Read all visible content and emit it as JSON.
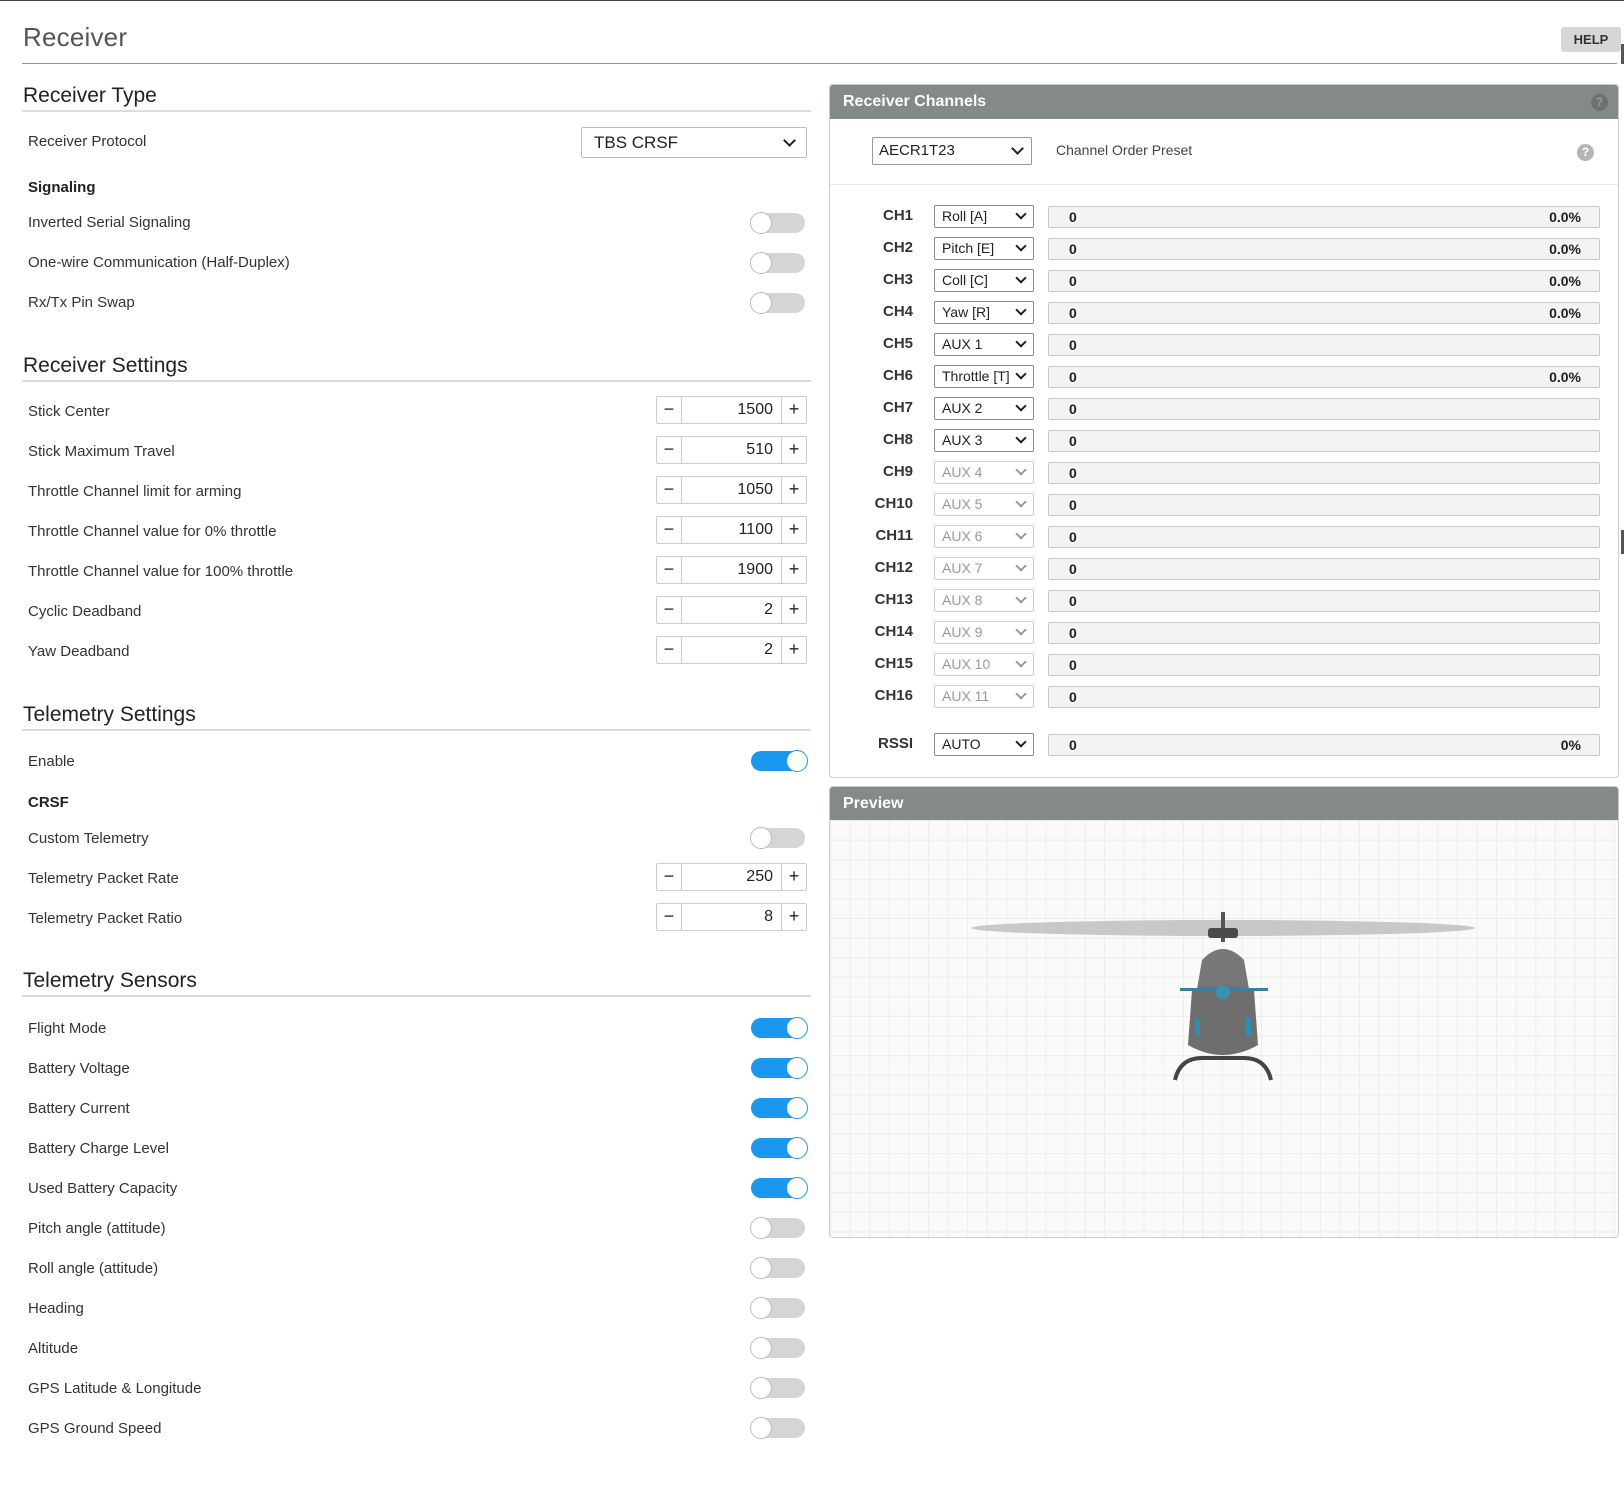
{
  "header": {
    "title": "Receiver",
    "help_label": "HELP"
  },
  "receiver_type": {
    "title": "Receiver Type",
    "protocol_label": "Receiver Protocol",
    "protocol_value": "TBS CRSF",
    "signaling_label": "Signaling",
    "toggles": [
      {
        "label": "Inverted Serial Signaling",
        "on": false
      },
      {
        "label": "One-wire Communication (Half-Duplex)",
        "on": false
      },
      {
        "label": "Rx/Tx Pin Swap",
        "on": false
      }
    ]
  },
  "receiver_settings": {
    "title": "Receiver Settings",
    "fields": [
      {
        "label": "Stick Center",
        "value": "1500"
      },
      {
        "label": "Stick Maximum Travel",
        "value": "510"
      },
      {
        "label": "Throttle Channel limit for arming",
        "value": "1050"
      },
      {
        "label": "Throttle Channel value for 0% throttle",
        "value": "1100"
      },
      {
        "label": "Throttle Channel value for 100% throttle",
        "value": "1900"
      },
      {
        "label": "Cyclic Deadband",
        "value": "2"
      },
      {
        "label": "Yaw Deadband",
        "value": "2"
      }
    ],
    "minus": "−",
    "plus": "+"
  },
  "telemetry_settings": {
    "title": "Telemetry Settings",
    "enable_label": "Enable",
    "enable_on": true,
    "crsf_label": "CRSF",
    "custom_label": "Custom Telemetry",
    "custom_on": false,
    "packet_rate_label": "Telemetry Packet Rate",
    "packet_rate_value": "250",
    "packet_ratio_label": "Telemetry Packet Ratio",
    "packet_ratio_value": "8"
  },
  "telemetry_sensors": {
    "title": "Telemetry Sensors",
    "items": [
      {
        "label": "Flight Mode",
        "on": true
      },
      {
        "label": "Battery Voltage",
        "on": true
      },
      {
        "label": "Battery Current",
        "on": true
      },
      {
        "label": "Battery Charge Level",
        "on": true
      },
      {
        "label": "Used Battery Capacity",
        "on": true
      },
      {
        "label": "Pitch angle (attitude)",
        "on": false
      },
      {
        "label": "Roll angle (attitude)",
        "on": false
      },
      {
        "label": "Heading",
        "on": false
      },
      {
        "label": "Altitude",
        "on": false
      },
      {
        "label": "GPS Latitude & Longitude",
        "on": false
      },
      {
        "label": "GPS Ground Speed",
        "on": false
      }
    ]
  },
  "channels_panel": {
    "title": "Receiver Channels",
    "preset_value": "AECR1T23",
    "preset_label": "Channel Order Preset",
    "help_icon": "?",
    "channels": [
      {
        "name": "CH1",
        "map": "Roll [A]",
        "value": "0",
        "percent": "0.0%",
        "enabled": true
      },
      {
        "name": "CH2",
        "map": "Pitch [E]",
        "value": "0",
        "percent": "0.0%",
        "enabled": true
      },
      {
        "name": "CH3",
        "map": "Coll [C]",
        "value": "0",
        "percent": "0.0%",
        "enabled": true
      },
      {
        "name": "CH4",
        "map": "Yaw [R]",
        "value": "0",
        "percent": "0.0%",
        "enabled": true
      },
      {
        "name": "CH5",
        "map": "AUX 1",
        "value": "0",
        "percent": "",
        "enabled": true
      },
      {
        "name": "CH6",
        "map": "Throttle [T]",
        "value": "0",
        "percent": "0.0%",
        "enabled": true
      },
      {
        "name": "CH7",
        "map": "AUX 2",
        "value": "0",
        "percent": "",
        "enabled": true
      },
      {
        "name": "CH8",
        "map": "AUX 3",
        "value": "0",
        "percent": "",
        "enabled": true
      },
      {
        "name": "CH9",
        "map": "AUX 4",
        "value": "0",
        "percent": "",
        "enabled": false
      },
      {
        "name": "CH10",
        "map": "AUX 5",
        "value": "0",
        "percent": "",
        "enabled": false
      },
      {
        "name": "CH11",
        "map": "AUX 6",
        "value": "0",
        "percent": "",
        "enabled": false
      },
      {
        "name": "CH12",
        "map": "AUX 7",
        "value": "0",
        "percent": "",
        "enabled": false
      },
      {
        "name": "CH13",
        "map": "AUX 8",
        "value": "0",
        "percent": "",
        "enabled": false
      },
      {
        "name": "CH14",
        "map": "AUX 9",
        "value": "0",
        "percent": "",
        "enabled": false
      },
      {
        "name": "CH15",
        "map": "AUX 10",
        "value": "0",
        "percent": "",
        "enabled": false
      },
      {
        "name": "CH16",
        "map": "AUX 11",
        "value": "0",
        "percent": "",
        "enabled": false
      }
    ],
    "rssi": {
      "name": "RSSI",
      "map": "AUTO",
      "value": "0",
      "percent": "0%"
    }
  },
  "preview_panel": {
    "title": "Preview"
  },
  "colors": {
    "accent": "#1a98f0",
    "panel_header": "#848a85",
    "title_rule": "#5aa5c8"
  },
  "icons": {
    "help_icon": "question-circle-icon",
    "dropdown_icon": "chevron-down-icon",
    "preview_model": "helicopter-model"
  }
}
